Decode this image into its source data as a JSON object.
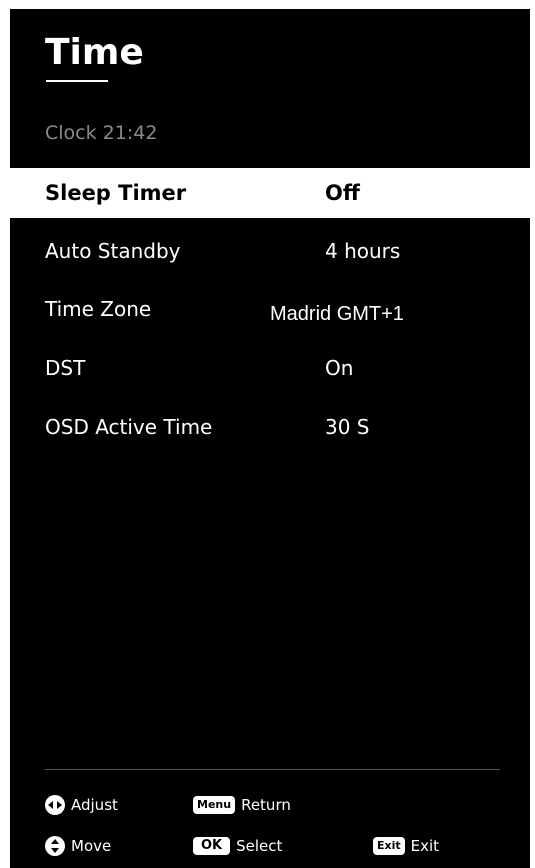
{
  "header": {
    "title": "Time",
    "clock": "Clock 21:42"
  },
  "menu": {
    "items": [
      {
        "label": "Sleep Timer",
        "value": "Off",
        "selected": true
      },
      {
        "label": "Auto Standby",
        "value": "4 hours",
        "selected": false
      },
      {
        "label": "Time Zone",
        "value": "Madrid GMT+1",
        "selected": false
      },
      {
        "label": "DST",
        "value": "On",
        "selected": false
      },
      {
        "label": "OSD Active Time",
        "value": "30 S",
        "selected": false
      }
    ]
  },
  "footer": {
    "adjust": {
      "icon": "left-right-arrows-icon",
      "label": "Adjust"
    },
    "return": {
      "key": "Menu",
      "label": "Return"
    },
    "move": {
      "icon": "up-down-arrows-icon",
      "label": "Move"
    },
    "select": {
      "key": "OK",
      "label": "Select"
    },
    "exit": {
      "key": "Exit",
      "label": "Exit"
    }
  },
  "colors": {
    "background": "#000000",
    "text": "#ffffff",
    "selected_background": "#ffffff",
    "selected_text": "#000000",
    "dim_text": "#8a8a8a"
  }
}
